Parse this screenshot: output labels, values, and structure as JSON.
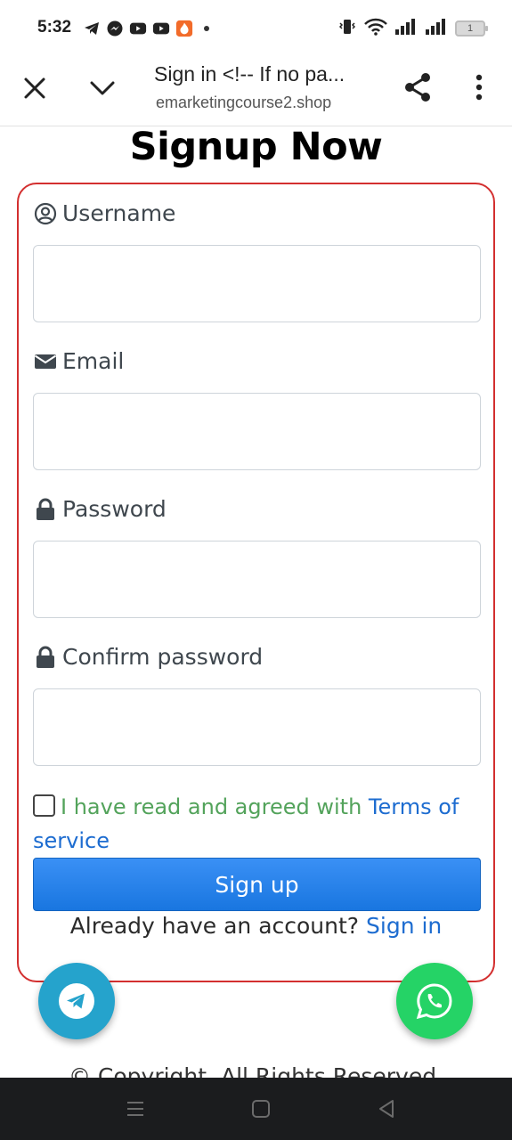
{
  "status_bar": {
    "time": "5:32",
    "battery": "1"
  },
  "browser": {
    "title": "Sign in <!-- If no pa...",
    "url": "emarketingcourse2.shop"
  },
  "page": {
    "heading": "Signup Now",
    "fields": [
      {
        "label": "Username",
        "icon": "user-circle-icon"
      },
      {
        "label": "Email",
        "icon": "envelope-icon"
      },
      {
        "label": "Password",
        "icon": "lock-icon"
      },
      {
        "label": "Confirm password",
        "icon": "lock-icon"
      }
    ],
    "terms_text": "I have read and agreed with",
    "terms_link": "Terms of service",
    "signup_button": "Sign up",
    "already_text": "Already have an account?",
    "signin_link": "Sign in",
    "footer": "© Copyright. All Rights Reserved."
  },
  "colors": {
    "card_border": "#d32f2f",
    "button": "#1976e0",
    "link": "#1d6cd0",
    "terms_text": "#53a35b",
    "telegram": "#25a3cc",
    "whatsapp": "#25d366"
  }
}
